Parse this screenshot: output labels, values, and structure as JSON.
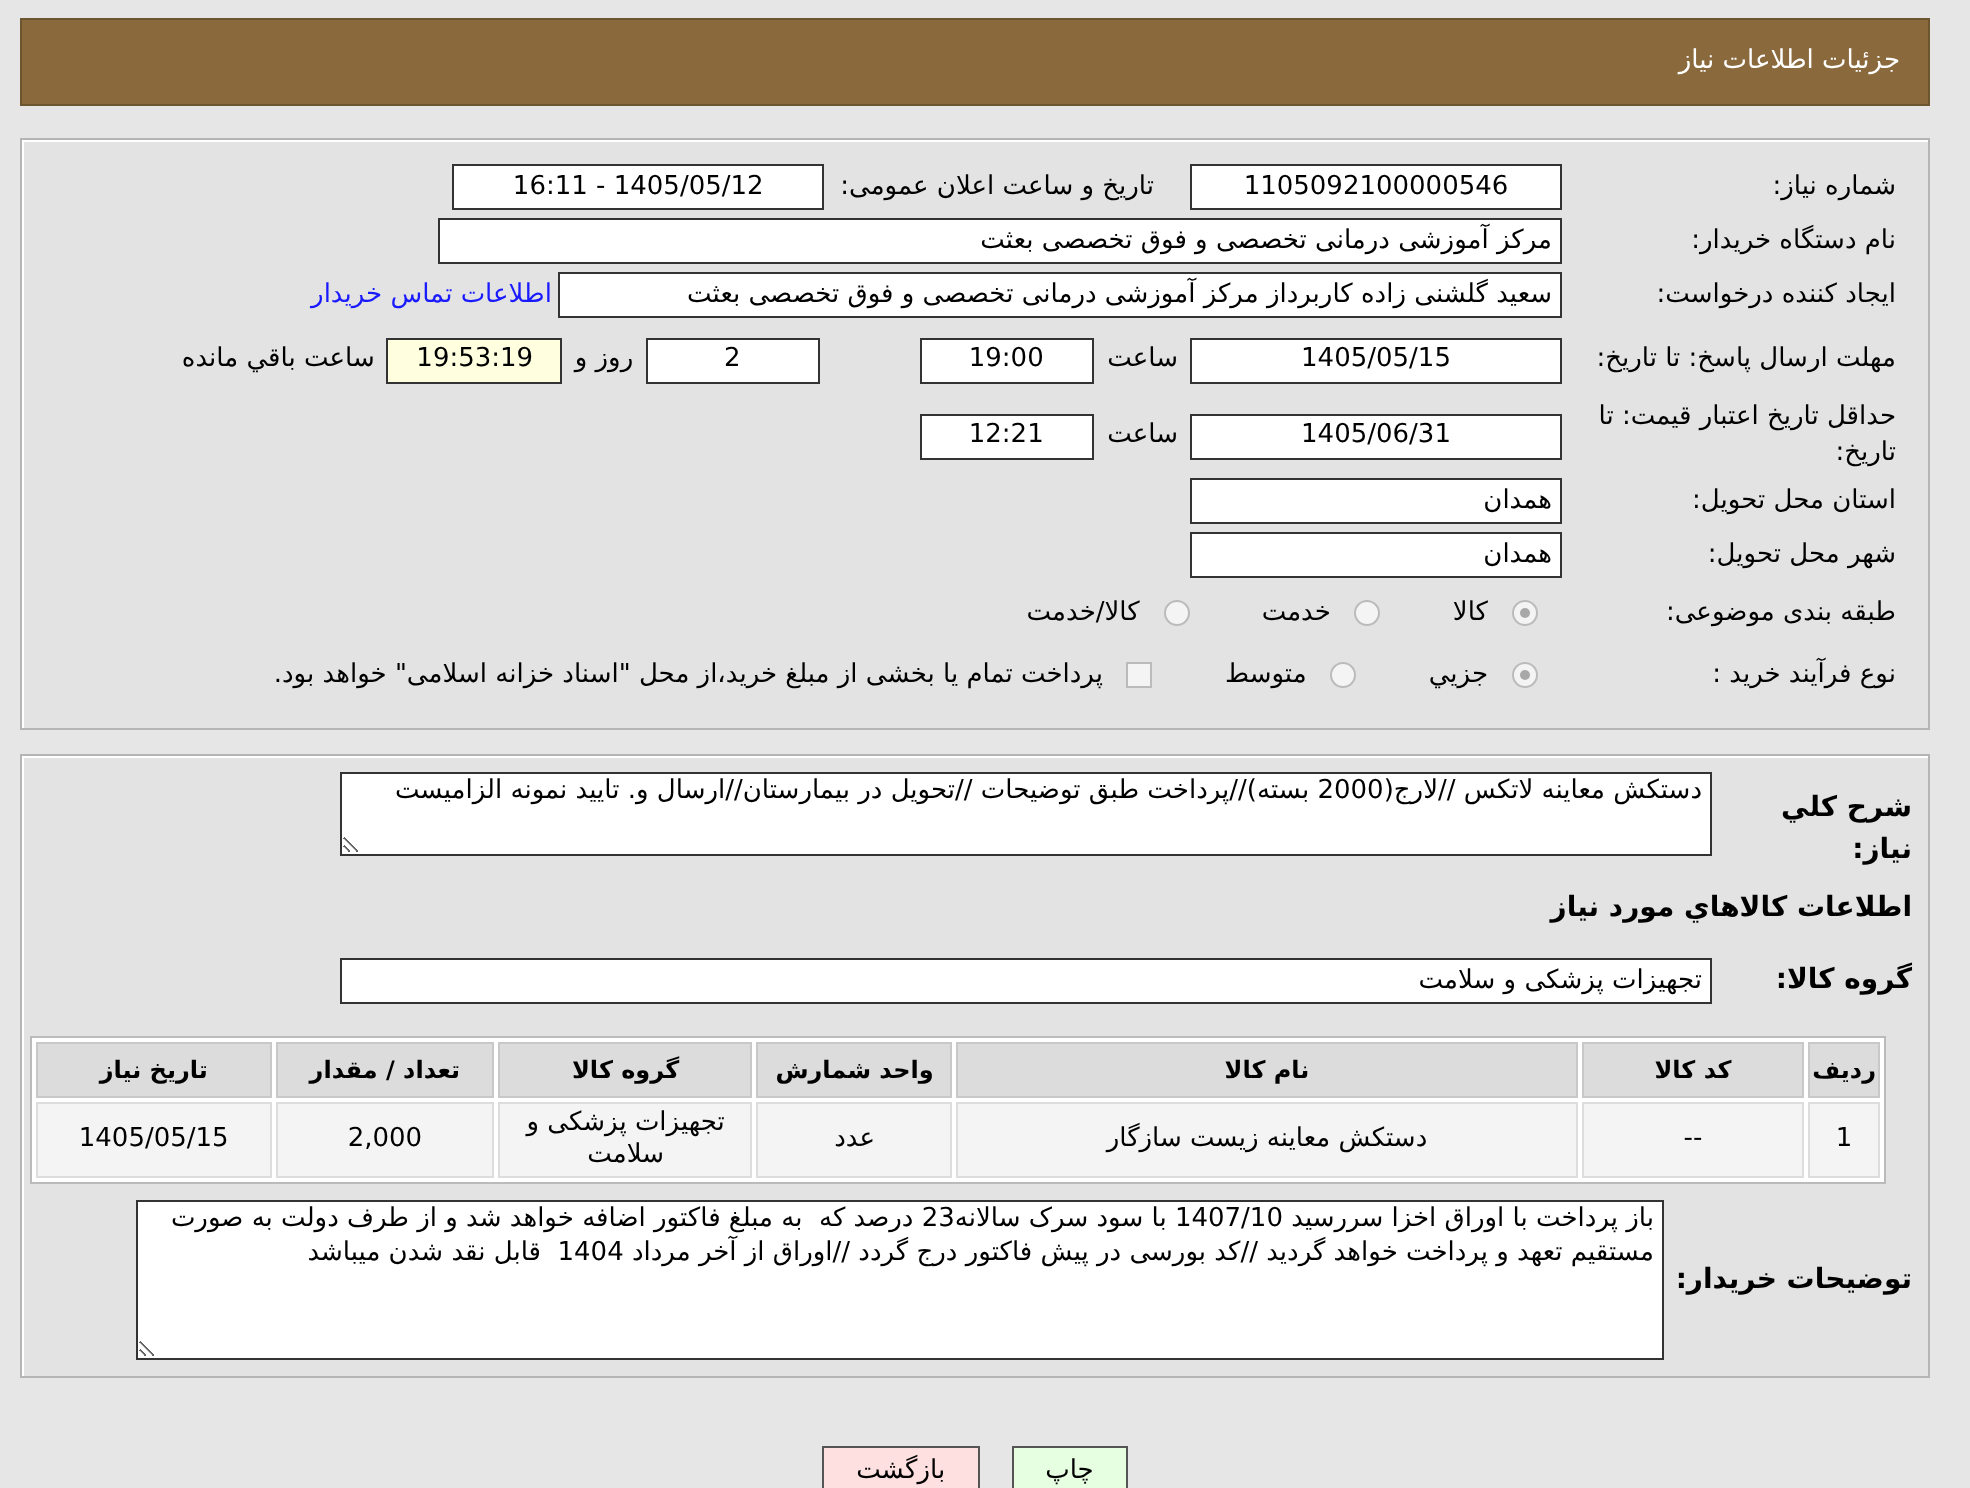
{
  "header": {
    "title": "جزئیات اطلاعات نیاز"
  },
  "need_number": {
    "label": "شماره نیاز:",
    "value": "1105092100000546"
  },
  "announce": {
    "label": "تاریخ و ساعت اعلان عمومی:",
    "value": "1405/05/12 - 16:11"
  },
  "buyer_org": {
    "label": "نام دستگاه خریدار:",
    "value": "مرکز آموزشی درمانی تخصصی و فوق تخصصی بعثت"
  },
  "requester": {
    "label": "ایجاد کننده درخواست:",
    "value": "سعید گلشنی زاده کاربرداز مرکز آموزشی درمانی تخصصی و فوق تخصصی بعثت",
    "contact_link": "اطلاعات تماس خریدار"
  },
  "response_deadline": {
    "label": "مهلت ارسال پاسخ: تا تاریخ:",
    "date": "1405/05/15",
    "time_label": "ساعت",
    "time": "19:00",
    "days": "2",
    "days_label": "روز و",
    "remaining": "19:53:19",
    "remaining_label": "ساعت باقي مانده"
  },
  "price_validity": {
    "label": "حداقل تاریخ اعتبار قیمت: تا تاریخ:",
    "date": "1405/06/31",
    "time_label": "ساعت",
    "time": "12:21"
  },
  "province": {
    "label": "استان محل تحویل:",
    "value": "همدان"
  },
  "city": {
    "label": "شهر محل تحویل:",
    "value": "همدان"
  },
  "category": {
    "label": "طبقه بندی موضوعی:",
    "options": [
      {
        "label": "كالا",
        "selected": true
      },
      {
        "label": "خدمت",
        "selected": false
      },
      {
        "label": "كالا/خدمت",
        "selected": false
      }
    ]
  },
  "process": {
    "label": "نوع فرآیند خرید :",
    "options": [
      {
        "label": "جزيي",
        "selected": true
      },
      {
        "label": "متوسط",
        "selected": false
      }
    ],
    "payment_checkbox": {
      "label": "پرداخت تمام یا بخشی از مبلغ خرید،از محل \"اسناد خزانه اسلامی\" خواهد بود.",
      "checked": false
    }
  },
  "description": {
    "label": "شرح كلي نياز:",
    "value": "دستکش معاینه لاتکس //لارج(2000 بسته)//پرداخت طبق توضیحات //تحویل در بیمارستان//ارسال و. تایید نمونه الزامیست"
  },
  "goods_heading": "اطلاعات كالاهاي مورد نياز",
  "goods_group": {
    "label": "گروه کالا:",
    "value": "تجهیزات پزشکی و سلامت"
  },
  "table": {
    "columns": [
      "ردیف",
      "کد کالا",
      "نام کالا",
      "واحد شمارش",
      "گروه کالا",
      "تعداد / مقدار",
      "تاریخ نیاز"
    ],
    "rows": [
      [
        "1",
        "--",
        "دستکش معاینه زیست سازگار",
        "عدد",
        "تجهیزات پزشکی و سلامت",
        "2,000",
        "1405/05/15"
      ]
    ]
  },
  "buyer_notes": {
    "label": "توضیحات خریدار:",
    "value": "باز پرداخت با اوراق اخزا سررسید 1407/10 با سود سرک سالانه23 درصد که  به مبلغ فاکتور اضافه خواهد شد و از طرف دولت به صورت مستقیم تعهد و پرداخت خواهد گردید //کد بورسی در پیش فاکتور درج گردد //اوراق از آخر مرداد 1404  قابل نقد شدن میباشد"
  },
  "buttons": [
    {
      "label": "چاپ",
      "kind": "print"
    },
    {
      "label": "بازگشت",
      "kind": "back"
    }
  ]
}
